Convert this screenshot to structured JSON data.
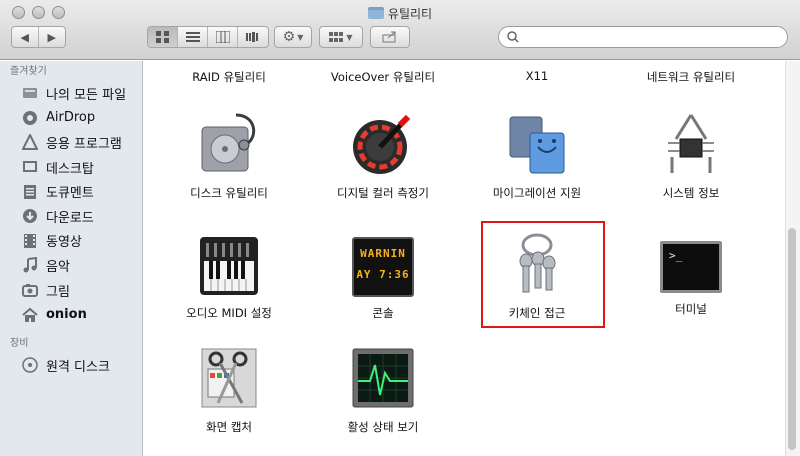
{
  "window": {
    "title": "유틸리티"
  },
  "toolbar": {
    "view_modes": [
      "icon",
      "list",
      "column",
      "coverflow"
    ],
    "active_view": "icon"
  },
  "search": {
    "placeholder": ""
  },
  "sidebar": {
    "sections": [
      {
        "title": "즐겨찾기",
        "items": [
          {
            "label": "나의 모든 파일",
            "icon": "all-files-icon"
          },
          {
            "label": "AirDrop",
            "icon": "airdrop-icon"
          },
          {
            "label": "응용 프로그램",
            "icon": "applications-icon"
          },
          {
            "label": "데스크탑",
            "icon": "desktop-icon"
          },
          {
            "label": "도큐멘트",
            "icon": "documents-icon"
          },
          {
            "label": "다운로드",
            "icon": "downloads-icon"
          },
          {
            "label": "동영상",
            "icon": "movies-icon"
          },
          {
            "label": "음악",
            "icon": "music-icon"
          },
          {
            "label": "그림",
            "icon": "pictures-icon"
          },
          {
            "label": "onion",
            "icon": "home-icon"
          }
        ]
      },
      {
        "title": "장비",
        "items": [
          {
            "label": "원격 디스크",
            "icon": "remote-disc-icon"
          }
        ]
      }
    ]
  },
  "apps": [
    {
      "label": "RAID 유틸리티",
      "icon": "raid-utility-icon"
    },
    {
      "label": "VoiceOver 유틸리티",
      "icon": "voiceover-utility-icon"
    },
    {
      "label": "X11",
      "icon": "x11-icon"
    },
    {
      "label": "네트워크 유틸리티",
      "icon": "network-utility-icon"
    },
    {
      "label": "디스크 유틸리티",
      "icon": "disk-utility-icon"
    },
    {
      "label": "디지털 컬러 측정기",
      "icon": "digital-color-meter-icon"
    },
    {
      "label": "마이그레이션 지원",
      "icon": "migration-assistant-icon"
    },
    {
      "label": "시스템 정보",
      "icon": "system-information-icon"
    },
    {
      "label": "오디오 MIDI 설정",
      "icon": "audio-midi-setup-icon"
    },
    {
      "label": "콘솔",
      "icon": "console-icon",
      "screen_text": [
        "WARNIN",
        "AY 7:36"
      ]
    },
    {
      "label": "키체인 접근",
      "icon": "keychain-access-icon",
      "highlighted": true
    },
    {
      "label": "터미널",
      "icon": "terminal-icon",
      "screen_text": ">_"
    },
    {
      "label": "화면 캡처",
      "icon": "grab-icon"
    },
    {
      "label": "활성 상태 보기",
      "icon": "activity-monitor-icon"
    }
  ],
  "colors": {
    "highlight": "#e01515",
    "sidebar_bg": "#e3e8ee"
  }
}
